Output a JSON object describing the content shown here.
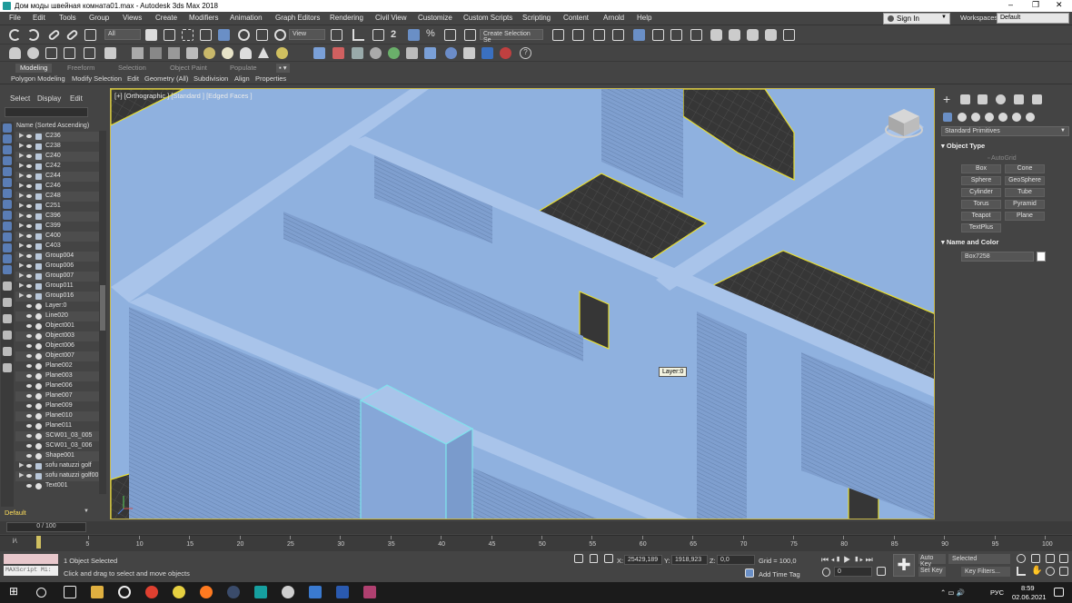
{
  "window": {
    "title": "Дом моды швейная комната01.max - Autodesk 3ds Max 2018",
    "min": "–",
    "max": "❐",
    "close": "✕"
  },
  "menu": [
    "File",
    "Edit",
    "Tools",
    "Group",
    "Views",
    "Create",
    "Modifiers",
    "Animation",
    "Graph Editors",
    "Rendering",
    "Civil View",
    "Customize",
    "Custom Scripts",
    "Scripting",
    "Content",
    "Arnold",
    "Help"
  ],
  "account": {
    "sign_in": "Sign In",
    "workspaces_label": "Workspaces:",
    "workspace": "Default"
  },
  "toolbar": {
    "filter": "All",
    "view": "View",
    "selection_set": "Create Selection Se"
  },
  "ribbon": {
    "tabs": [
      "Modeling",
      "Freeform",
      "Selection",
      "Object Paint",
      "Populate"
    ],
    "items": [
      "Polygon Modeling",
      "Modify Selection",
      "Edit",
      "Geometry (All)",
      "Subdivision",
      "Align",
      "Properties"
    ]
  },
  "explorer": {
    "tabs": [
      "Select",
      "Display",
      "Edit"
    ],
    "header": "Name (Sorted Ascending)",
    "items": [
      {
        "name": "C236",
        "type": "group"
      },
      {
        "name": "C238",
        "type": "group"
      },
      {
        "name": "C240",
        "type": "group"
      },
      {
        "name": "C242",
        "type": "group"
      },
      {
        "name": "C244",
        "type": "group"
      },
      {
        "name": "C246",
        "type": "group"
      },
      {
        "name": "C248",
        "type": "group"
      },
      {
        "name": "C251",
        "type": "group"
      },
      {
        "name": "C396",
        "type": "group"
      },
      {
        "name": "C399",
        "type": "group"
      },
      {
        "name": "C400",
        "type": "group"
      },
      {
        "name": "C403",
        "type": "group"
      },
      {
        "name": "Group004",
        "type": "group"
      },
      {
        "name": "Group006",
        "type": "group"
      },
      {
        "name": "Group007",
        "type": "group"
      },
      {
        "name": "Group011",
        "type": "group"
      },
      {
        "name": "Group016",
        "type": "group"
      },
      {
        "name": "Layer:0",
        "type": "obj"
      },
      {
        "name": "Line020",
        "type": "obj"
      },
      {
        "name": "Object001",
        "type": "obj"
      },
      {
        "name": "Object003",
        "type": "obj"
      },
      {
        "name": "Object006",
        "type": "obj"
      },
      {
        "name": "Object007",
        "type": "obj"
      },
      {
        "name": "Plane002",
        "type": "obj"
      },
      {
        "name": "Plane003",
        "type": "obj"
      },
      {
        "name": "Plane006",
        "type": "obj"
      },
      {
        "name": "Plane007",
        "type": "obj"
      },
      {
        "name": "Plane009",
        "type": "obj"
      },
      {
        "name": "Plane010",
        "type": "obj"
      },
      {
        "name": "Plane011",
        "type": "obj"
      },
      {
        "name": "SCW01_03_005",
        "type": "obj"
      },
      {
        "name": "SCW01_03_006",
        "type": "obj"
      },
      {
        "name": "Shape001",
        "type": "obj"
      },
      {
        "name": "sofu natuzzi golf",
        "type": "group"
      },
      {
        "name": "sofu natuzzi golf00",
        "type": "group"
      },
      {
        "name": "Text001",
        "type": "obj"
      }
    ]
  },
  "layer": "Default",
  "viewport": {
    "label": "[+] [Orthographic ] [Standard ] [Edged Faces ]",
    "tooltip": "Layer:0",
    "wall_color": "#8fb1df",
    "floor_color": "#3b3b3b",
    "edge_color": "#f0e030"
  },
  "command": {
    "category": "Standard Primitives",
    "rollout_object_type": "Object Type",
    "autogrid": "AutoGrid",
    "buttons": [
      "Box",
      "Cone",
      "Sphere",
      "GeoSphere",
      "Cylinder",
      "Tube",
      "Torus",
      "Pyramid",
      "Teapot",
      "Plane",
      "TextPlus"
    ],
    "rollout_name_color": "Name and Color",
    "object_name": "Box7258"
  },
  "time": {
    "slider": "0 / 100",
    "ticks": [
      "5",
      "10",
      "15",
      "20",
      "25",
      "30",
      "35",
      "40",
      "45",
      "50",
      "55",
      "60",
      "65",
      "70",
      "75",
      "80",
      "85",
      "90",
      "95",
      "100"
    ]
  },
  "status": {
    "maxscript": "MAXScript Mi:",
    "selected": "1 Object Selected",
    "prompt": "Click and drag to select and move objects",
    "x_label": "X:",
    "x": "25429,189",
    "y_label": "Y:",
    "y": "1918,923",
    "z_label": "Z:",
    "z": "0,0",
    "grid": "Grid = 100,0",
    "add_time_tag": "Add Time Tag",
    "frame": "0",
    "auto_key": "Auto Key",
    "set_key": "Set Key",
    "key_mode": "Selected",
    "key_filters": "Key Filters..."
  },
  "taskbar": {
    "lang": "РУС",
    "time": "8:59",
    "date": "02.06.2021"
  }
}
